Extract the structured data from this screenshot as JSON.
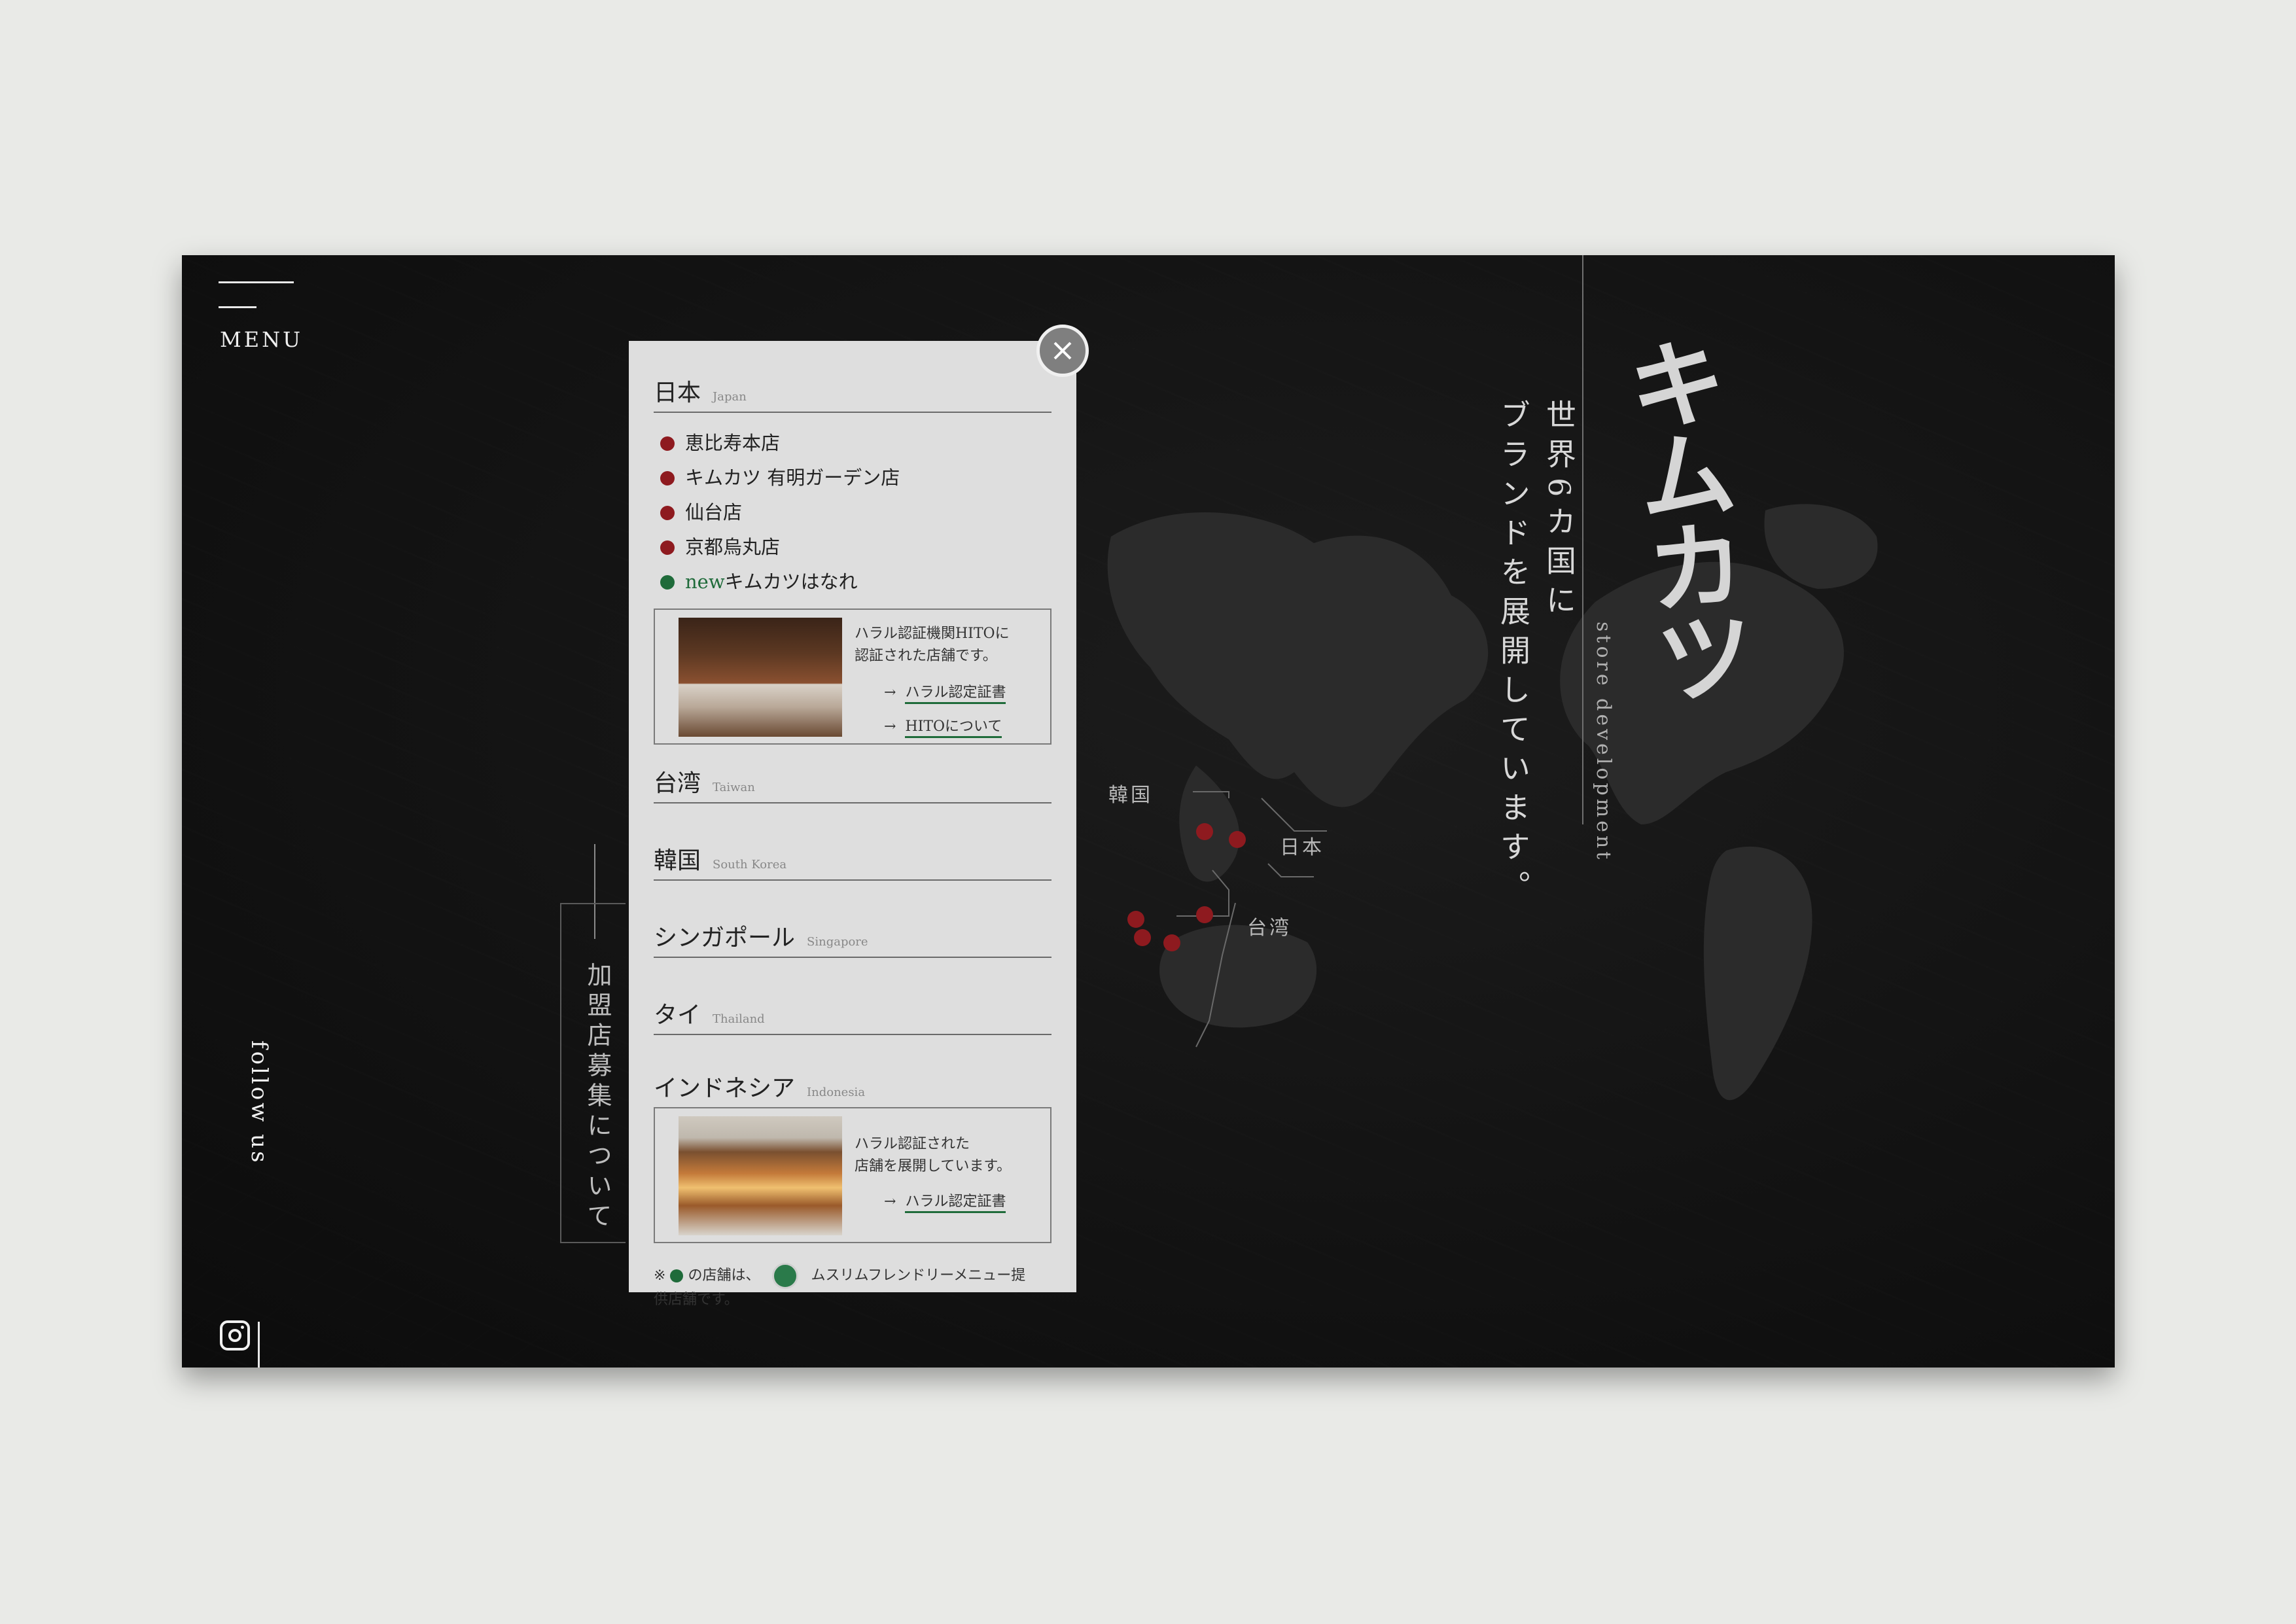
{
  "menu": {
    "label": "MENU"
  },
  "follow": {
    "label": "follow us",
    "icon": "instagram-icon"
  },
  "franchise": {
    "label": "加盟店募集について"
  },
  "headline": {
    "line1": "世界6カ国に",
    "line2": "ブランドを展開しています。"
  },
  "brand": {
    "logo_text": "キムカツ",
    "subtitle": "store development"
  },
  "map": {
    "labels": {
      "korea": "韓国",
      "japan": "日本",
      "taiwan": "台湾"
    },
    "dot_color": "#8e1a1f"
  },
  "panel": {
    "countries": [
      {
        "jp": "日本",
        "en": "Japan"
      },
      {
        "jp": "台湾",
        "en": "Taiwan"
      },
      {
        "jp": "韓国",
        "en": "South Korea"
      },
      {
        "jp": "シンガポール",
        "en": "Singapore"
      },
      {
        "jp": "タイ",
        "en": "Thailand"
      },
      {
        "jp": "インドネシア",
        "en": "Indonesia"
      }
    ],
    "japan_stores": [
      {
        "name": "恵比寿本店",
        "color": "#8e1a1f"
      },
      {
        "name": "キムカツ 有明ガーデン店",
        "color": "#8e1a1f"
      },
      {
        "name": "仙台店",
        "color": "#8e1a1f"
      },
      {
        "name": "京都烏丸店",
        "color": "#8e1a1f"
      },
      {
        "new": "new",
        "name": "キムカツはなれ",
        "color": "#1f6b3a"
      }
    ],
    "japan_halal": {
      "desc1": "ハラル認証機関HITOに",
      "desc2": "認証された店舗です。",
      "link1": "ハラル認定証書",
      "link2": "HITOについて",
      "arrow": "→"
    },
    "indonesia_halal": {
      "desc1": "ハラル認証された",
      "desc2": "店舗を展開しています。",
      "link1": "ハラル認定証書",
      "arrow": "→"
    },
    "note": {
      "prefix": "※",
      "mid": "の店舗は、",
      "text": "ムスリムフレンドリーメニュー提",
      "text2": "供店舗です。"
    }
  },
  "colors": {
    "accent_red": "#8e1a1f",
    "accent_green": "#1f6b3a",
    "panel_bg": "#dedede"
  }
}
